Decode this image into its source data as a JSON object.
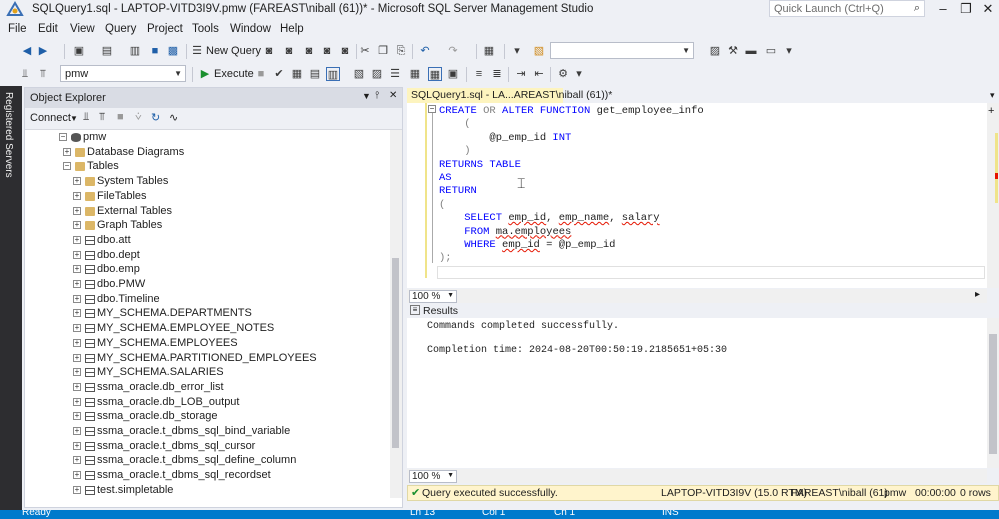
{
  "window": {
    "title": "SQLQuery1.sql - LAPTOP-VITD3I9V.pmw (FAREAST\\niball (61))* - Microsoft SQL Server Management Studio",
    "quick_launch_placeholder": "Quick Launch (Ctrl+Q)"
  },
  "menu": [
    "File",
    "Edit",
    "View",
    "Query",
    "Project",
    "Tools",
    "Window",
    "Help"
  ],
  "toolbar1": {
    "new_query_label": "New Query"
  },
  "toolbar2": {
    "database_value": "pmw",
    "execute_label": "Execute"
  },
  "side_strip": {
    "label": "Registered Servers"
  },
  "object_explorer": {
    "title": "Object Explorer",
    "connect_label": "Connect",
    "tree": [
      {
        "label": "pmw",
        "type": "db",
        "level": 0,
        "expander": "−"
      },
      {
        "label": "Database Diagrams",
        "type": "folder",
        "level": 1,
        "expander": "+"
      },
      {
        "label": "Tables",
        "type": "folder",
        "level": 1,
        "expander": "−"
      },
      {
        "label": "System Tables",
        "type": "folder",
        "level": 2,
        "expander": "+"
      },
      {
        "label": "FileTables",
        "type": "folder",
        "level": 2,
        "expander": "+"
      },
      {
        "label": "External Tables",
        "type": "folder",
        "level": 2,
        "expander": "+"
      },
      {
        "label": "Graph Tables",
        "type": "folder",
        "level": 2,
        "expander": "+"
      },
      {
        "label": "dbo.att",
        "type": "table",
        "level": 2,
        "expander": "+"
      },
      {
        "label": "dbo.dept",
        "type": "table",
        "level": 2,
        "expander": "+"
      },
      {
        "label": "dbo.emp",
        "type": "table",
        "level": 2,
        "expander": "+"
      },
      {
        "label": "dbo.PMW",
        "type": "table",
        "level": 2,
        "expander": "+"
      },
      {
        "label": "dbo.Timeline",
        "type": "table",
        "level": 2,
        "expander": "+"
      },
      {
        "label": "MY_SCHEMA.DEPARTMENTS",
        "type": "table",
        "level": 2,
        "expander": "+"
      },
      {
        "label": "MY_SCHEMA.EMPLOYEE_NOTES",
        "type": "table",
        "level": 2,
        "expander": "+"
      },
      {
        "label": "MY_SCHEMA.EMPLOYEES",
        "type": "table",
        "level": 2,
        "expander": "+"
      },
      {
        "label": "MY_SCHEMA.PARTITIONED_EMPLOYEES",
        "type": "table",
        "level": 2,
        "expander": "+"
      },
      {
        "label": "MY_SCHEMA.SALARIES",
        "type": "table",
        "level": 2,
        "expander": "+"
      },
      {
        "label": "ssma_oracle.db_error_list",
        "type": "table",
        "level": 2,
        "expander": "+"
      },
      {
        "label": "ssma_oracle.db_LOB_output",
        "type": "table",
        "level": 2,
        "expander": "+"
      },
      {
        "label": "ssma_oracle.db_storage",
        "type": "table",
        "level": 2,
        "expander": "+"
      },
      {
        "label": "ssma_oracle.t_dbms_sql_bind_variable",
        "type": "table",
        "level": 2,
        "expander": "+"
      },
      {
        "label": "ssma_oracle.t_dbms_sql_cursor",
        "type": "table",
        "level": 2,
        "expander": "+"
      },
      {
        "label": "ssma_oracle.t_dbms_sql_define_column",
        "type": "table",
        "level": 2,
        "expander": "+"
      },
      {
        "label": "ssma_oracle.t_dbms_sql_recordset",
        "type": "table",
        "level": 2,
        "expander": "+"
      },
      {
        "label": "test.simpletable",
        "type": "table",
        "level": 2,
        "expander": "+"
      }
    ]
  },
  "editor": {
    "tab_label": "SQLQuery1.sql - LA...AREAST\\niball (61))*",
    "zoom": "100 %",
    "lines": [
      [
        {
          "t": "CREATE",
          "c": "kw"
        },
        {
          "t": " "
        },
        {
          "t": "OR",
          "c": "op"
        },
        {
          "t": " "
        },
        {
          "t": "ALTER",
          "c": "kw"
        },
        {
          "t": " "
        },
        {
          "t": "FUNCTION",
          "c": "kw"
        },
        {
          "t": " get_employee_info"
        }
      ],
      [
        {
          "t": "    "
        },
        {
          "t": "(",
          "c": "op"
        }
      ],
      [
        {
          "t": "        @p_emp_id "
        },
        {
          "t": "INT",
          "c": "kw"
        }
      ],
      [
        {
          "t": "    "
        },
        {
          "t": ")",
          "c": "op"
        }
      ],
      [
        {
          "t": "RETURNS",
          "c": "kw"
        },
        {
          "t": " "
        },
        {
          "t": "TABLE",
          "c": "kw"
        }
      ],
      [
        {
          "t": "AS",
          "c": "kw"
        }
      ],
      [
        {
          "t": "RETURN",
          "c": "kw"
        }
      ],
      [
        {
          "t": "(",
          "c": "op"
        }
      ],
      [
        {
          "t": "    "
        },
        {
          "t": "SELECT",
          "c": "kw"
        },
        {
          "t": " "
        },
        {
          "t": "emp_id",
          "c": "sq"
        },
        {
          "t": ", "
        },
        {
          "t": "emp_name",
          "c": "sq"
        },
        {
          "t": ", "
        },
        {
          "t": "salary",
          "c": "sq"
        }
      ],
      [
        {
          "t": "    "
        },
        {
          "t": "FROM",
          "c": "kw"
        },
        {
          "t": " "
        },
        {
          "t": "ma.employees",
          "c": "sq"
        }
      ],
      [
        {
          "t": "    "
        },
        {
          "t": "WHERE",
          "c": "kw"
        },
        {
          "t": " "
        },
        {
          "t": "emp_id",
          "c": "sq"
        },
        {
          "t": " = @p_emp_id"
        }
      ],
      [
        {
          "t": ");",
          "c": "op"
        }
      ]
    ]
  },
  "results": {
    "tab_label": "Results",
    "zoom": "100 %",
    "lines": [
      "Commands completed successfully.",
      "",
      "Completion time: 2024-08-20T00:50:19.2185651+05:30"
    ]
  },
  "query_status": {
    "message": "Query executed successfully.",
    "server": "LAPTOP-VITD3I9V (15.0 RTM)",
    "user": "FAREAST\\niball (61)",
    "database": "pmw",
    "elapsed": "00:00:00",
    "rows": "0 rows"
  },
  "statusbar": {
    "ready": "Ready",
    "ln": "Ln 13",
    "col": "Col 1",
    "ch": "Ch 1",
    "mode": "INS"
  },
  "colors": {
    "keyword": "#0000ff",
    "accent": "#007acc",
    "tab_active": "#fdf4bf",
    "status_ok": "#fff4cc"
  }
}
